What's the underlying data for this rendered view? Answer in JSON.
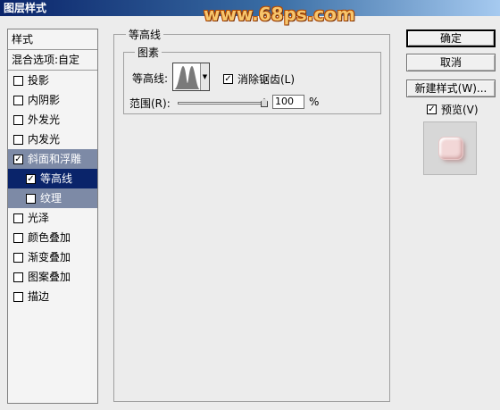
{
  "window": {
    "title": "图层样式",
    "watermark": "www.68ps.com"
  },
  "sidebar": {
    "header": "样式",
    "blend_options": "混合选项:自定",
    "items": [
      {
        "label": "投影",
        "checked": false
      },
      {
        "label": "内阴影",
        "checked": false
      },
      {
        "label": "外发光",
        "checked": false
      },
      {
        "label": "内发光",
        "checked": false
      },
      {
        "label": "斜面和浮雕",
        "checked": true
      },
      {
        "label": "等高线",
        "checked": true
      },
      {
        "label": "纹理",
        "checked": false
      },
      {
        "label": "光泽",
        "checked": false
      },
      {
        "label": "颜色叠加",
        "checked": false
      },
      {
        "label": "渐变叠加",
        "checked": false
      },
      {
        "label": "图案叠加",
        "checked": false
      },
      {
        "label": "描边",
        "checked": false
      }
    ]
  },
  "panel": {
    "group_title": "等高线",
    "subgroup_title": "图素",
    "contour_label": "等高线:",
    "antialias_label": "消除锯齿(L)",
    "antialias_checked": true,
    "range_label": "范围(R):",
    "range_value": "100",
    "range_unit": "%"
  },
  "buttons": {
    "ok": "确定",
    "cancel": "取消",
    "new_style": "新建样式(W)...",
    "preview_label": "预览(V)",
    "preview_checked": true
  },
  "colors": {
    "title_bar": "#0a246a",
    "selected": "#0a246a",
    "active_group": "#7d8aa6"
  }
}
